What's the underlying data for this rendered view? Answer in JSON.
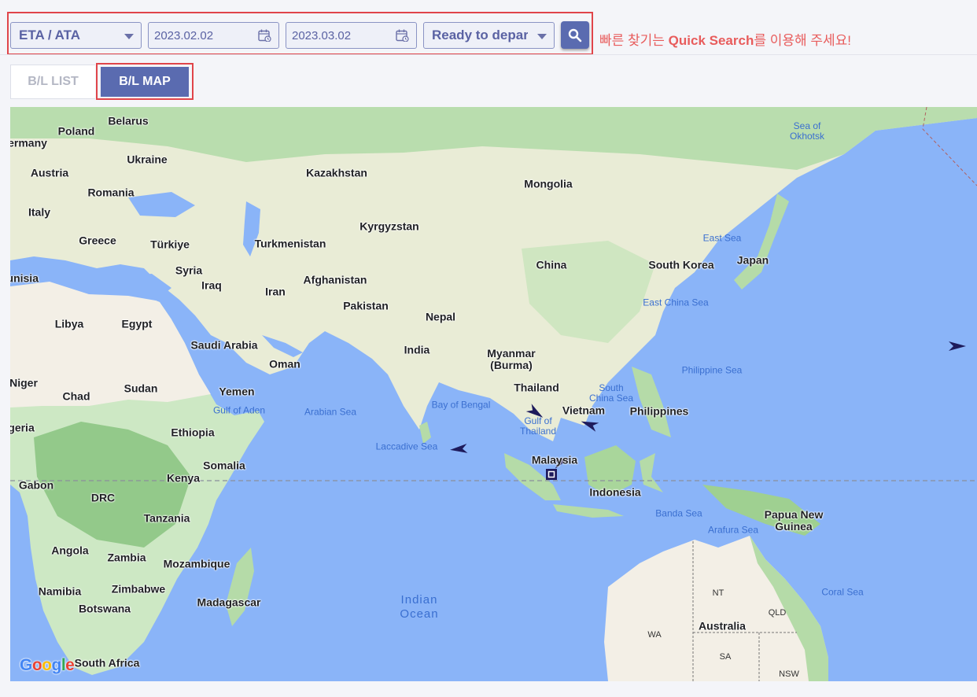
{
  "filters": {
    "date_type": "ETA / ATA",
    "date_from": "2023.02.02",
    "date_to": "2023.03.02",
    "status": "Ready to departure"
  },
  "hint": {
    "prefix": "빠른 찾기는 ",
    "highlight": "Quick Search",
    "suffix": "를 이용해 주세요!"
  },
  "tabs": {
    "list": "B/L LIST",
    "map": "B/L MAP",
    "active": "map"
  },
  "colors": {
    "accent": "#5a6bb0",
    "highlight_box": "#e0454a",
    "hint": "#e85c5c",
    "water": "#8ab4f8",
    "land": "#cde8c4"
  },
  "map": {
    "countries": [
      "Poland",
      "Belarus",
      "ermany",
      "Ukraine",
      "Austria",
      "Romania",
      "Kazakhstan",
      "Mongolia",
      "Italy",
      "Greece",
      "Türkiye",
      "Turkmenistan",
      "Kyrgyzstan",
      "China",
      "South Korea",
      "Japan",
      "Syria",
      "Iraq",
      "Iran",
      "Afghanistan",
      "Tunisia",
      "Pakistan",
      "Libya",
      "Egypt",
      "Nepal",
      "Saudi Arabia",
      "India",
      "Oman",
      "Niger",
      "Chad",
      "Sudan",
      "Yemen",
      "Myanmar\n(Burma)",
      "Thailand",
      "Vietnam",
      "Philippines",
      "geria",
      "Ethiopia",
      "Somalia",
      "Malaysia",
      "Kenya",
      "Gabon",
      "DRC",
      "Indonesia",
      "Papua New\nGuinea",
      "Tanzania",
      "Angola",
      "Zambia",
      "Mozambique",
      "Namibia",
      "Zimbabwe",
      "Botswana",
      "Madagascar",
      "Australia",
      "South Africa"
    ],
    "seas": [
      "Sea of\nOkhotsk",
      "East Sea",
      "East China Sea",
      "Philippine Sea",
      "South\nChina Sea",
      "Gulf of Aden",
      "Arabian Sea",
      "Bay of Bengal",
      "Gulf of\nThailand",
      "Laccadive Sea",
      "Banda Sea",
      "Arafura Sea",
      "Coral Sea"
    ],
    "ocean": "Indian\nOcean",
    "states": [
      "NT",
      "QLD",
      "WA",
      "SA",
      "NSW"
    ],
    "attribution": "Google",
    "vessel_markers": 5,
    "port_markers": 1
  }
}
